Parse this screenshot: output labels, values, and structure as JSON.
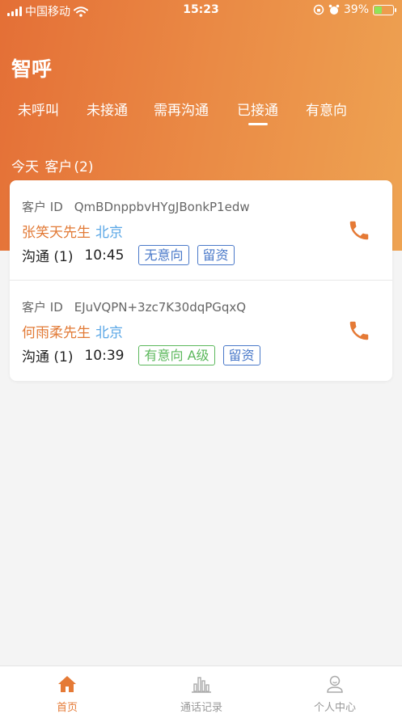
{
  "status_bar": {
    "carrier": "中国移动",
    "time": "15:23",
    "battery": "39%",
    "battery_level": 0.39,
    "icons": [
      "signal-icon",
      "wifi-icon",
      "lock-rotation-icon",
      "alarm-icon",
      "battery-charging-icon"
    ]
  },
  "header": {
    "title": "智呼"
  },
  "tabs": [
    {
      "label": "未呼叫",
      "active": false
    },
    {
      "label": "未接通",
      "active": false
    },
    {
      "label": "需再沟通",
      "active": false
    },
    {
      "label": "已接通",
      "active": true
    },
    {
      "label": "有意向",
      "active": false
    }
  ],
  "section": {
    "day": "今天",
    "label": "客户",
    "count": "(2)"
  },
  "customers": [
    {
      "id_label": "客户 ID",
      "id": "QmBDnppbvHYgJBonkP1edw",
      "name": "张笑天先生",
      "city": "北京",
      "comm_label": "沟通 (1)",
      "time": "10:45",
      "tags": [
        {
          "text": "无意向",
          "color": "#4a79c9"
        },
        {
          "text": "留资",
          "color": "#4a79c9"
        }
      ]
    },
    {
      "id_label": "客户 ID",
      "id": "EJuVQPN+3zc7K30dqPGqxQ",
      "name": "何雨柔先生",
      "city": "北京",
      "comm_label": "沟通 (1)",
      "time": "10:39",
      "tags": [
        {
          "text": "有意向 A级",
          "color": "#5cb85c"
        },
        {
          "text": "留资",
          "color": "#4a79c9"
        }
      ]
    }
  ],
  "tabbar": [
    {
      "label": "首页",
      "icon": "home-icon",
      "active": true
    },
    {
      "label": "通话记录",
      "icon": "bar-chart-icon",
      "active": false
    },
    {
      "label": "个人中心",
      "icon": "user-icon",
      "active": false
    }
  ],
  "colors": {
    "accent": "#e57a36",
    "header_gradient_start": "#e46f36",
    "header_gradient_end": "#eea352",
    "city_blue": "#5aa7e6"
  }
}
